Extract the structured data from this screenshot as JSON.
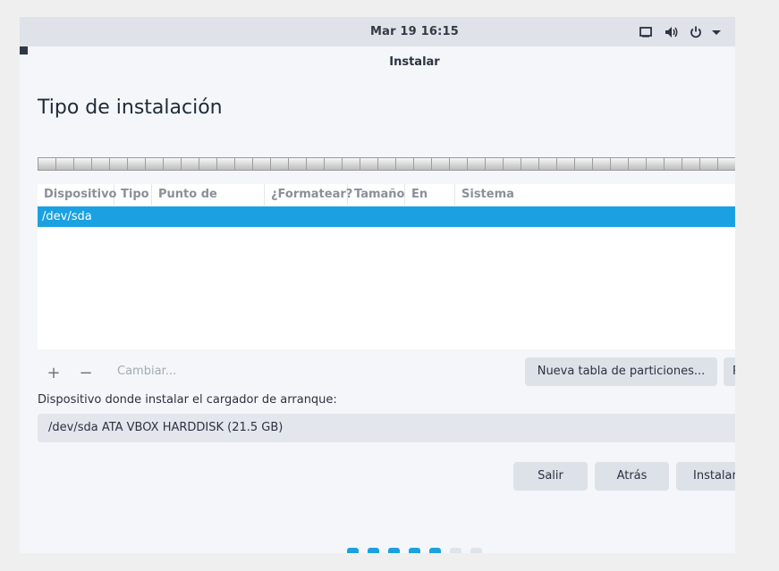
{
  "topbar": {
    "clock": "Mar 19  16:15",
    "tray_icons": [
      "display-icon",
      "volume-icon",
      "power-icon",
      "dropdown-arrow-icon"
    ]
  },
  "window": {
    "title": "Instalar",
    "heading": "Tipo de instalación"
  },
  "partition_table": {
    "columns": [
      "Dispositivo",
      "Tipo",
      "Punto de montaje",
      "¿Formatear?",
      "Tamaño",
      "En uso",
      "Sistema"
    ],
    "rows": [
      {
        "device": "/dev/sda"
      }
    ]
  },
  "toolbar": {
    "add_label": "+",
    "remove_label": "−",
    "change_label": "Cambiar...",
    "new_table_label": "Nueva tabla de particiones...",
    "revert_label": "R"
  },
  "bootloader": {
    "label": "Dispositivo donde instalar el cargador de arranque:",
    "selected": "/dev/sda ATA VBOX HARDDISK (21.5 GB)"
  },
  "actions": {
    "quit_label": "Salir",
    "back_label": "Atrás",
    "install_label": "Instalar ahora"
  },
  "progress": {
    "total_steps": 7,
    "completed_steps": 5
  },
  "colors": {
    "accent": "#1ba1e2",
    "inactive_dot": "#dfe3ea"
  }
}
